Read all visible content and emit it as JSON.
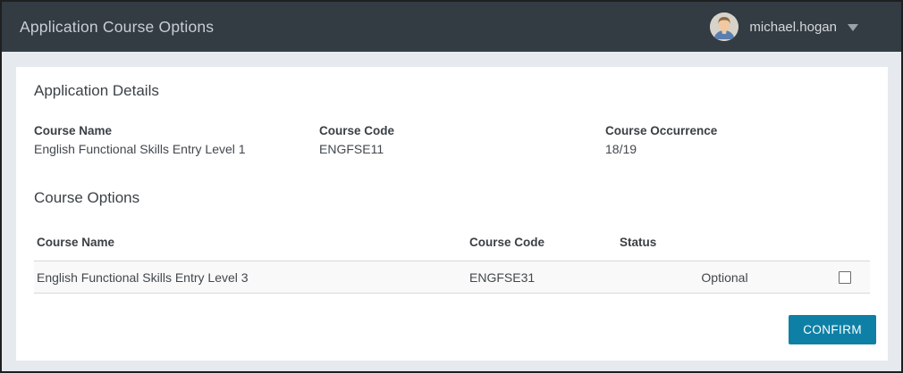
{
  "header": {
    "title": "Application Course Options",
    "user_name": "michael.hogan"
  },
  "application_details": {
    "heading": "Application Details",
    "fields": [
      {
        "label": "Course Name",
        "value": "English Functional Skills Entry Level 1"
      },
      {
        "label": "Course Code",
        "value": "ENGFSE11"
      },
      {
        "label": "Course Occurrence",
        "value": "18/19"
      }
    ]
  },
  "course_options": {
    "heading": "Course Options",
    "table": {
      "headers": [
        "Course Name",
        "Course Code",
        "Status"
      ],
      "rows": [
        {
          "course_name": "English Functional Skills Entry Level 3",
          "course_code": "ENGFSE31",
          "status": "Optional",
          "checked": false
        }
      ]
    },
    "confirm_label": "CONFIRM"
  },
  "colors": {
    "header_bg": "#333b43",
    "accent": "#0e80a6",
    "page_bg": "#e6eaee",
    "row_bg": "#f9f9f9"
  }
}
